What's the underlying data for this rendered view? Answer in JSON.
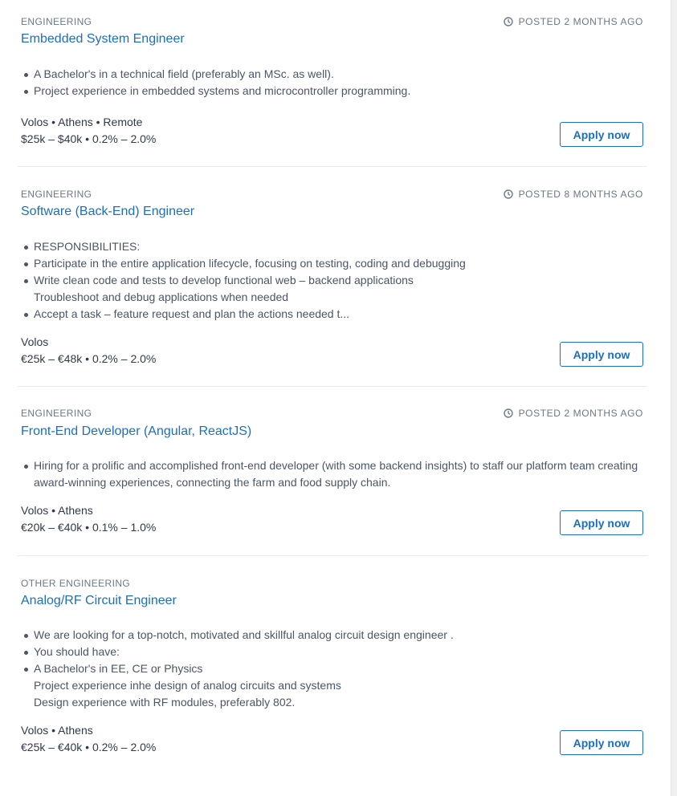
{
  "jobs": [
    {
      "category": "ENGINEERING",
      "posted": "POSTED 2 MONTHS AGO",
      "title": "Embedded System Engineer",
      "bullets": [
        {
          "text": "A Bachelor's in a technical field (preferably an MSc. as well).",
          "dot": true
        },
        {
          "text": "Project experience in embedded systems and microcontroller programming.",
          "dot": true
        }
      ],
      "locations": "Volos • Athens • Remote",
      "compensation": "$25k – $40k • 0.2% – 2.0%",
      "apply_label": "Apply now"
    },
    {
      "category": "ENGINEERING",
      "posted": "POSTED 8 MONTHS AGO",
      "title": "Software (Back-End) Engineer",
      "bullets": [
        {
          "text": "RESPONSIBILITIES:",
          "dot": true
        },
        {
          "text": "Participate in the entire application lifecycle, focusing on testing, coding and debugging",
          "dot": true
        },
        {
          "text": "Write clean code and tests to develop functional web – backend applications",
          "dot": true
        },
        {
          "text": "Troubleshoot and debug applications when needed",
          "dot": false
        },
        {
          "text": "Accept a task – feature request and plan the actions needed t...",
          "dot": true
        }
      ],
      "locations": "Volos",
      "compensation": "€25k – €48k • 0.2% – 2.0%",
      "apply_label": "Apply now"
    },
    {
      "category": "ENGINEERING",
      "posted": "POSTED 2 MONTHS AGO",
      "title": "Front-End Developer (Angular, ReactJS)",
      "bullets": [
        {
          "text": "Hiring for a prolific and accomplished front-end developer (with some backend insights) to staff our platform team creating",
          "dot": true
        },
        {
          "text": "award-winning experiences, connecting the farm and food supply chain.",
          "dot": false
        }
      ],
      "locations": "Volos • Athens",
      "compensation": "€20k – €40k • 0.1% – 1.0%",
      "apply_label": "Apply now"
    },
    {
      "category": "OTHER ENGINEERING",
      "posted": "",
      "title": "Analog/RF Circuit Engineer",
      "bullets": [
        {
          "text": "We are looking for a top-notch, motivated and skillful analog circuit design engineer .",
          "dot": true
        },
        {
          "text": "You should have:",
          "dot": true
        },
        {
          "text": "A Bachelor's in EE, CE or Physics",
          "dot": true
        },
        {
          "text": "Project experience inhe design of analog circuits and systems",
          "dot": false
        },
        {
          "text": "Design experience with RF modules, preferably 802.",
          "dot": false
        }
      ],
      "locations": "Volos • Athens",
      "compensation": "€25k – €40k • 0.2% – 2.0%",
      "apply_label": "Apply now"
    }
  ]
}
